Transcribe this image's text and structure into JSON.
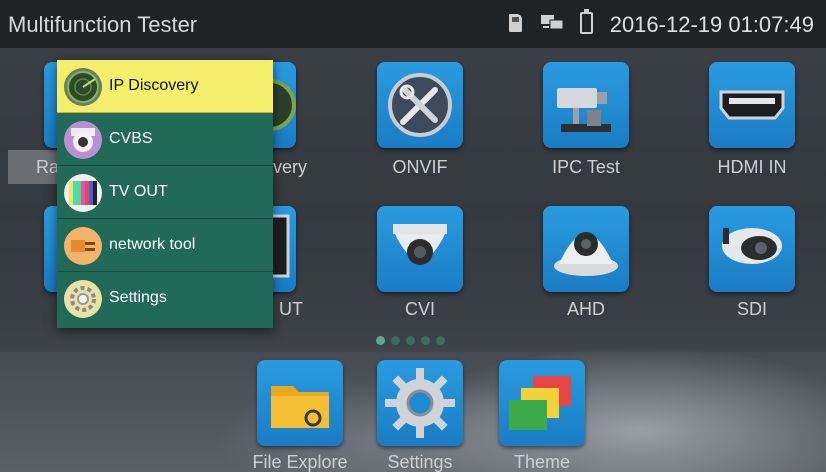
{
  "status_bar": {
    "title": "Multifunction Tester",
    "datetime": "2016-12-19 01:07:49"
  },
  "apps": {
    "row1": [
      {
        "label": "Ra",
        "icon": "radar-icon"
      },
      {
        "label": "very",
        "icon": "ip-discovery-icon"
      },
      {
        "label": "ONVIF",
        "icon": "onvif-tools-icon"
      },
      {
        "label": "IPC Test",
        "icon": "ipc-camera-icon"
      },
      {
        "label": "HDMI IN",
        "icon": "hdmi-port-icon"
      }
    ],
    "row2": [
      {
        "label": "UT",
        "icon": "tv-out-icon"
      },
      {
        "label": "CVI",
        "icon": "dome-camera-icon"
      },
      {
        "label": "AHD",
        "icon": "dome-camera-icon"
      },
      {
        "label": "SDI",
        "icon": "bullet-camera-icon"
      }
    ],
    "dock": [
      {
        "label": "File Explore",
        "icon": "folder-icon"
      },
      {
        "label": "Settings",
        "icon": "gear-icon"
      },
      {
        "label": "Theme",
        "icon": "theme-icon"
      }
    ]
  },
  "popup_menu": {
    "items": [
      {
        "label": "IP Discovery",
        "icon": "radar-icon",
        "selected": true
      },
      {
        "label": "CVBS",
        "icon": "camera-icon",
        "selected": false
      },
      {
        "label": "TV OUT",
        "icon": "color-bars-icon",
        "selected": false
      },
      {
        "label": "network tool",
        "icon": "network-tool-icon",
        "selected": false
      },
      {
        "label": "Settings",
        "icon": "settings-icon",
        "selected": false
      }
    ]
  },
  "pager": {
    "pages": 5,
    "current": 1
  },
  "colors": {
    "menu_bg": "#216a58",
    "menu_selected": "#f4ee6a",
    "app_tile": "#1f8bd3",
    "status_bar": "#1f2326"
  }
}
